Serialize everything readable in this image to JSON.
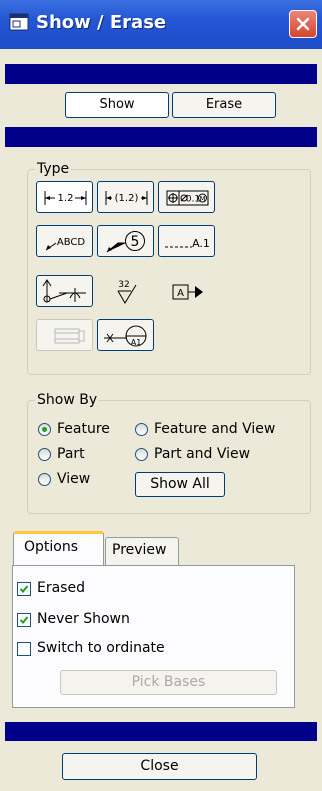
{
  "window": {
    "title": "Show / Erase"
  },
  "mode_buttons": {
    "show": "Show",
    "erase": "Erase"
  },
  "type_group": {
    "title": "Type",
    "items": [
      {
        "name": "dimension-icon",
        "label": "1.2"
      },
      {
        "name": "reference-dimension-icon",
        "label": "(1.2)"
      },
      {
        "name": "geometric-tolerance-icon",
        "label": "0.1"
      },
      {
        "name": "note-icon",
        "label": "ABCD"
      },
      {
        "name": "balloon-icon",
        "label": "5"
      },
      {
        "name": "datum-axis-icon",
        "label": "A.1"
      },
      {
        "name": "symbol-icon",
        "label": ""
      },
      {
        "name": "surface-finish-icon",
        "label": "32"
      },
      {
        "name": "datum-target-icon",
        "label": "A"
      },
      {
        "name": "cosmetic-feature-icon",
        "label": ""
      },
      {
        "name": "datum-target-balloon-icon",
        "label": "A1"
      }
    ]
  },
  "show_by": {
    "title": "Show By",
    "options": [
      "Feature",
      "Feature and View",
      "Part",
      "Part and View",
      "View"
    ],
    "selected": "Feature",
    "show_all": "Show All"
  },
  "tabs": {
    "options": "Options",
    "preview": "Preview",
    "active": "Options"
  },
  "options": {
    "erased": {
      "label": "Erased",
      "checked": true
    },
    "never_shown": {
      "label": "Never Shown",
      "checked": true
    },
    "switch_to_ordinate": {
      "label": "Switch to ordinate",
      "checked": false
    },
    "pick_bases": "Pick Bases"
  },
  "footer": {
    "close": "Close"
  },
  "colors": {
    "title_bar": "#2456d3",
    "band": "#00008b",
    "dialog_bg": "#ece9d8",
    "radio_dot": "#21a121"
  }
}
